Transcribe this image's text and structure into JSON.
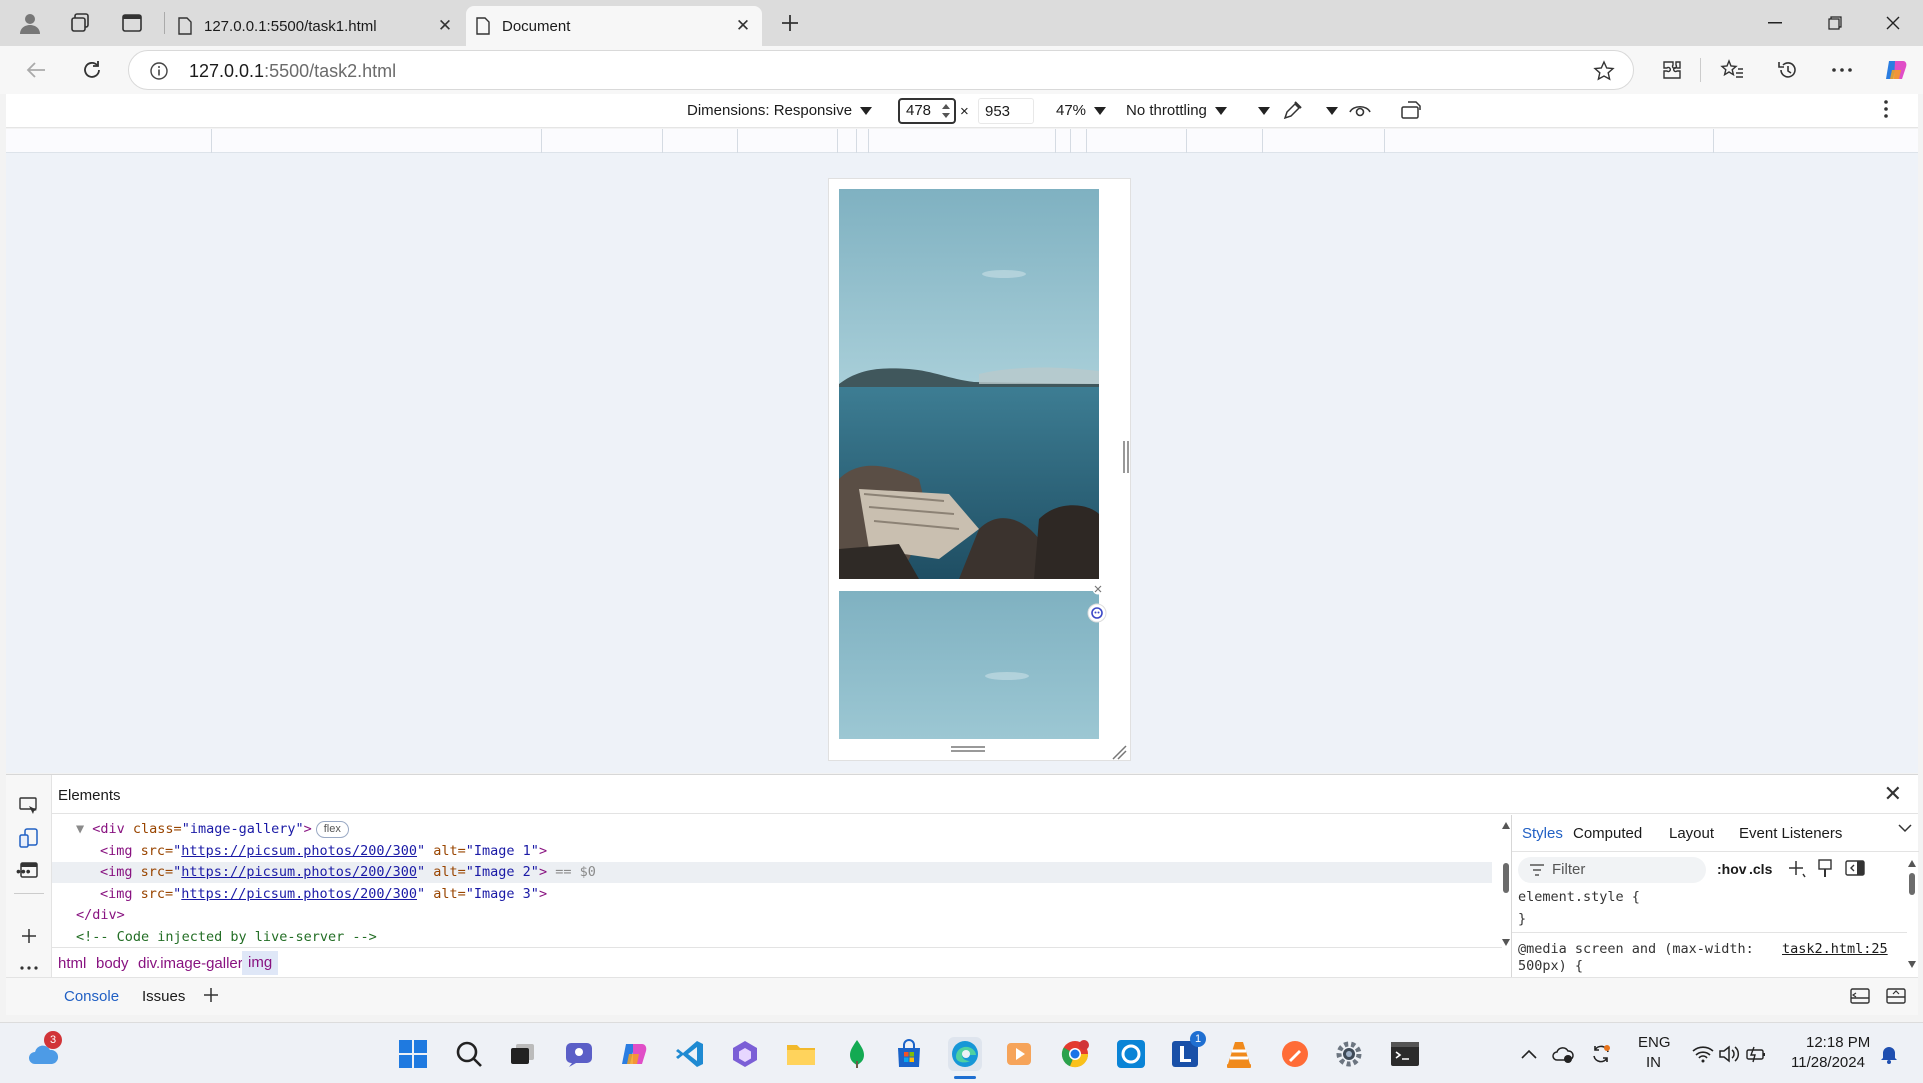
{
  "browser": {
    "tabs": [
      {
        "label": "127.0.0.1:5500/task1.html",
        "active": false
      },
      {
        "label": "Document",
        "active": true
      }
    ],
    "address": {
      "host": "127.0.0.1",
      "rest": ":5500/task2.html"
    }
  },
  "device_toolbar": {
    "dimensions_label": "Dimensions: Responsive",
    "width": "478",
    "times": "×",
    "height": "953",
    "zoom": "47%",
    "throttling": "No throttling"
  },
  "devtools": {
    "panel_title": "Elements",
    "code_lines": [
      {
        "indent": 1,
        "parts": [
          {
            "t": "▼ ",
            "c": "dim"
          },
          {
            "t": "<div ",
            "c": "tag"
          },
          {
            "t": "class=",
            "c": "attr"
          },
          {
            "t": "\"image-gallery\"",
            "c": "val"
          },
          {
            "t": ">",
            "c": "tag"
          }
        ],
        "badge": "flex"
      },
      {
        "indent": 2,
        "parts": [
          {
            "t": "<img ",
            "c": "tag"
          },
          {
            "t": "src=",
            "c": "attr"
          },
          {
            "t": "\"",
            "c": "val"
          },
          {
            "t": "https://picsum.photos/200/300",
            "c": "link"
          },
          {
            "t": "\"",
            "c": "val"
          },
          {
            "t": " alt=",
            "c": "attr"
          },
          {
            "t": "\"Image 1\"",
            "c": "val"
          },
          {
            "t": ">",
            "c": "tag"
          }
        ]
      },
      {
        "indent": 2,
        "selected": true,
        "parts": [
          {
            "t": "<img ",
            "c": "tag"
          },
          {
            "t": "src=",
            "c": "attr"
          },
          {
            "t": "\"",
            "c": "val"
          },
          {
            "t": "https://picsum.photos/200/300",
            "c": "link"
          },
          {
            "t": "\"",
            "c": "val"
          },
          {
            "t": " alt=",
            "c": "attr"
          },
          {
            "t": "\"Image 2\"",
            "c": "val"
          },
          {
            "t": ">",
            "c": "tag"
          },
          {
            "t": " == $0",
            "c": "dim"
          }
        ]
      },
      {
        "indent": 2,
        "parts": [
          {
            "t": "<img ",
            "c": "tag"
          },
          {
            "t": "src=",
            "c": "attr"
          },
          {
            "t": "\"",
            "c": "val"
          },
          {
            "t": "https://picsum.photos/200/300",
            "c": "link"
          },
          {
            "t": "\"",
            "c": "val"
          },
          {
            "t": " alt=",
            "c": "attr"
          },
          {
            "t": "\"Image 3\"",
            "c": "val"
          },
          {
            "t": ">",
            "c": "tag"
          }
        ]
      },
      {
        "indent": 1,
        "parts": [
          {
            "t": "</div>",
            "c": "tag"
          }
        ]
      },
      {
        "indent": 1,
        "parts": [
          {
            "t": "<!-- Code injected by live-server -->",
            "c": "comment"
          }
        ]
      }
    ],
    "breadcrumbs": [
      "html",
      "body",
      "div.image-gallery",
      "img"
    ],
    "bottom_tabs": [
      "Console",
      "Issues"
    ],
    "styles": {
      "tabs": [
        "Styles",
        "Computed",
        "Layout",
        "Event Listeners"
      ],
      "filter_placeholder": "Filter",
      "hov": ":hov",
      "cls": ".cls",
      "element_style": "element.style {",
      "close_brace": "}",
      "media_rule_1": "@media screen and (max-width:",
      "media_rule_2": "500px) {",
      "source": "task2.html:25"
    }
  },
  "taskbar": {
    "weather_badge": "3",
    "lang_1": "ENG",
    "lang_2": "IN",
    "time": "12:18 PM",
    "date": "11/28/2024",
    "l_badge": "1"
  }
}
